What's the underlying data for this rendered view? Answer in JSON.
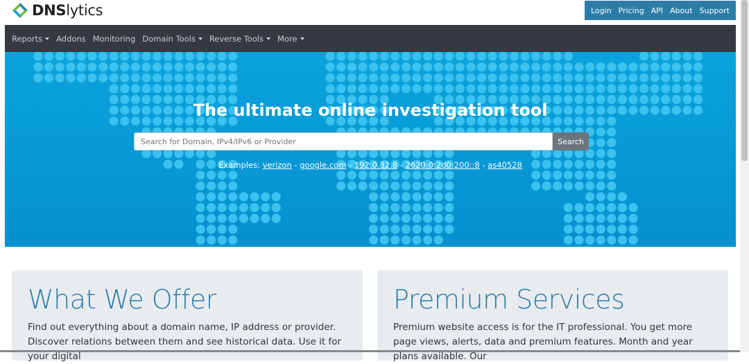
{
  "brand": {
    "name_bold": "DNS",
    "name_light": "lytics"
  },
  "toplinks": [
    "Login",
    "Pricing",
    "API",
    "About",
    "Support"
  ],
  "nav": [
    {
      "label": "Reports",
      "dropdown": true
    },
    {
      "label": "Addons",
      "dropdown": false
    },
    {
      "label": "Monitoring",
      "dropdown": false
    },
    {
      "label": "Domain Tools",
      "dropdown": true
    },
    {
      "label": "Reverse Tools",
      "dropdown": true
    },
    {
      "label": "More",
      "dropdown": true
    }
  ],
  "hero": {
    "title": "The ultimate online investigation tool",
    "search_placeholder": "Search for Domain, IPv4/IPv6 or Provider",
    "search_button": "Search",
    "examples_label": "Examples:",
    "examples": [
      "verizon",
      "google.com",
      "192.0.32.8",
      "2620:0:2d0:200::8",
      "as40528"
    ]
  },
  "cards": [
    {
      "title": "What We Offer",
      "text": "Find out everything about a domain name, IP address or provider. Discover relations between them and see historical data. Use it for your digital"
    },
    {
      "title": "Premium Services",
      "text": "Premium website access is for the IT professional. You get more page views, alerts, data and premium features. Month and year plans available. Our"
    }
  ],
  "colors": {
    "accent": "#2b7da8",
    "nav_bg": "#343a40",
    "hero_bg": "#0aa3dc",
    "dots": "#3bc2ee"
  }
}
